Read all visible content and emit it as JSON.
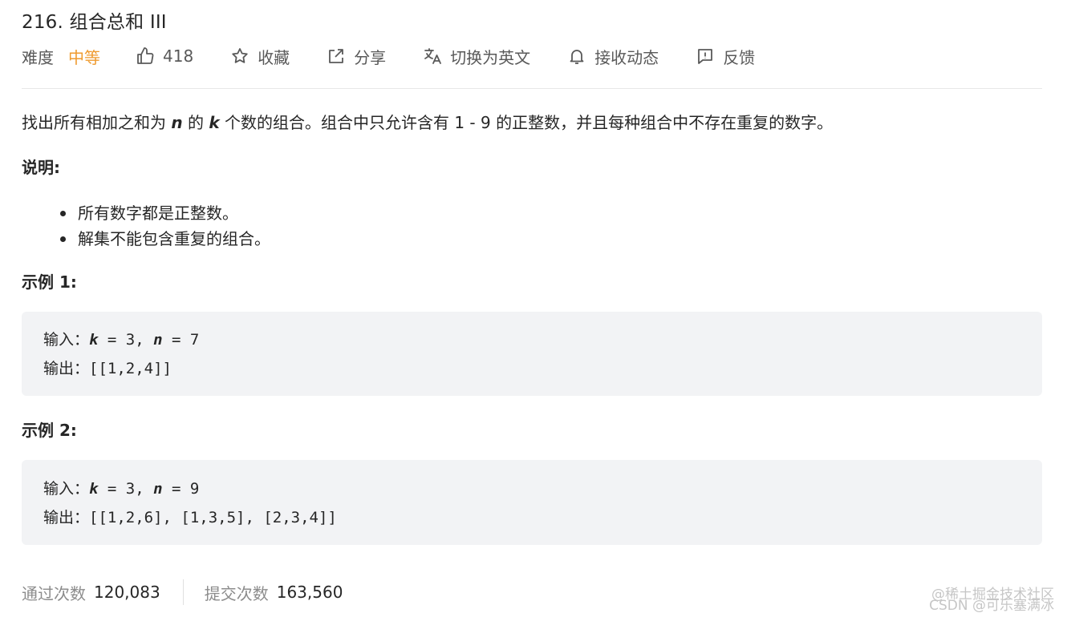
{
  "problem": {
    "title": "216. 组合总和 III",
    "difficulty_label": "难度",
    "difficulty": "中等",
    "likes": "418",
    "actions": {
      "favorite": "收藏",
      "share": "分享",
      "switch_lang": "切换为英文",
      "subscribe": "接收动态",
      "feedback": "反馈"
    },
    "description": {
      "part1": "找出所有相加之和为 ",
      "var_n": "n",
      "part2": " 的 ",
      "var_k": "k",
      "part3": " 个数的组合。组合中只允许含有 1 - 9 的正整数，并且每种组合中不存在重复的数字。"
    },
    "notes_title": "说明:",
    "notes": [
      "所有数字都是正整数。",
      "解集不能包含重复的组合。"
    ],
    "examples": [
      {
        "title": "示例 1:",
        "input_label": "输入：",
        "k": "k",
        "k_val": " = 3, ",
        "n": "n",
        "n_val": " = 7",
        "output_label": "输出：",
        "output": "[[1,2,4]]"
      },
      {
        "title": "示例 2:",
        "input_label": "输入：",
        "k": "k",
        "k_val": " = 3, ",
        "n": "n",
        "n_val": " = 9",
        "output_label": "输出：",
        "output": "[[1,2,6], [1,3,5], [2,3,4]]"
      }
    ],
    "stats": {
      "accepted_label": "通过次数",
      "accepted": "120,083",
      "submissions_label": "提交次数",
      "submissions": "163,560"
    }
  },
  "watermark": {
    "line1": "@稀土掘金技术社区",
    "line2": "CSDN @可乐塞满冰"
  },
  "colors": {
    "difficulty_medium": "#ef9a2e",
    "code_bg": "#f2f3f5"
  }
}
